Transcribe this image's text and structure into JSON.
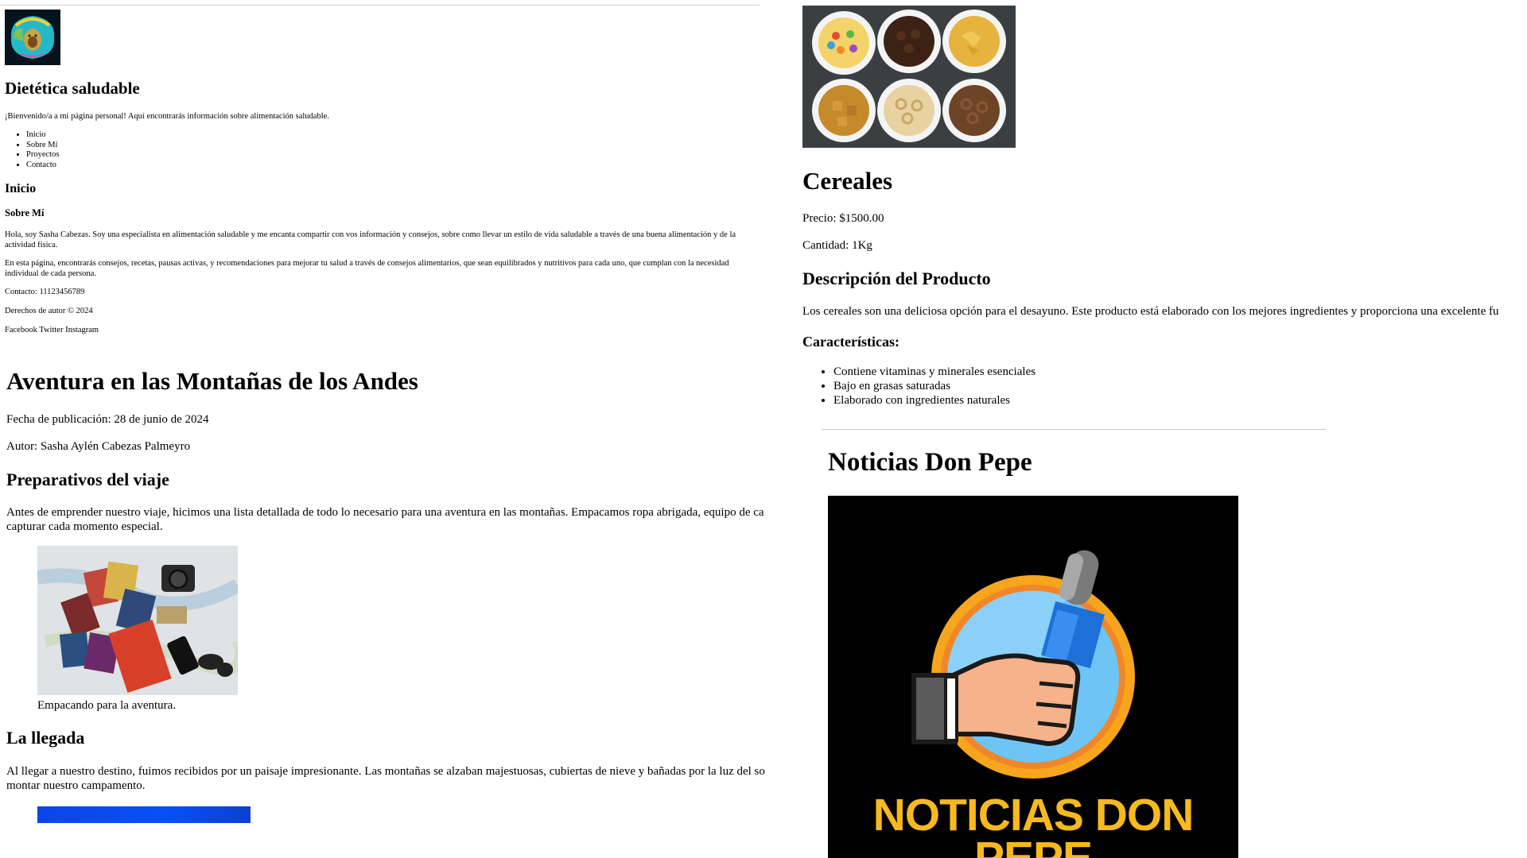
{
  "dietetica": {
    "logo_icon": "avocado-logo",
    "title": "Dietética saludable",
    "welcome": "¡Bienvenido/a a mi página personal! Aquí encontrarás información sobre alimentación saludable.",
    "nav": [
      "Inicio",
      "Sobre Mí",
      "Proyectos",
      "Contacto"
    ],
    "section_inicio": "Inicio",
    "section_sobre_mi": "Sobre Mí",
    "about_p1": "Hola, soy Sasha Cabezas. Soy una especialista en alimentación saludable y me encanta compartir con vos información y consejos, sobre como llevar un estilo de vida saludable a través de una buena alimentación y de la actividad física.",
    "about_p2": "En esta página, encontrarás consejos, recetas, pausas activas, y recomendaciones para mejorar tu salud a través de consejos alimentarios, que sean equilibrados y nutritivos para cada uno, que cumplan con la necesidad individual de cada persona.",
    "contact": "Contacto: 11123456789",
    "copyright": "Derechos de autor © 2024",
    "social": [
      "Facebook",
      "Twitter",
      "Instagram"
    ]
  },
  "aventura": {
    "title": "Aventura en las Montañas de los Andes",
    "date": "Fecha de publicación: 28 de junio de 2024",
    "author": "Autor: Sasha Aylén Cabezas Palmeyro",
    "section1_title": "Preparativos del viaje",
    "section1_text": "Antes de emprender nuestro viaje, hicimos una lista detallada de todo lo necesario para una aventura en las montañas. Empacamos ropa abrigada, equipo de ca",
    "section1_text_line2": "capturar cada momento especial.",
    "figure_caption": "Empacando para la aventura.",
    "section2_title": "La llegada",
    "section2_text": "Al llegar a nuestro destino, fuimos recibidos por un paisaje impresionante. Las montañas se alzaban majestuosas, cubiertas de nieve y bañadas por la luz del so",
    "section2_text_line2": "montar nuestro campamento."
  },
  "cereales": {
    "title": "Cereales",
    "price": "Precio: $1500.00",
    "quantity": "Cantidad: 1Kg",
    "desc_title": "Descripción del Producto",
    "description": "Los cereales son una deliciosa opción para el desayuno. Este producto está elaborado con los mejores ingredientes y proporciona una excelente fu",
    "features_title": "Características:",
    "features": [
      "Contiene vitaminas y minerales esenciales",
      "Bajo en grasas saturadas",
      "Elaborado con ingredientes naturales"
    ]
  },
  "noticias": {
    "title": "Noticias Don Pepe",
    "logo_line1": "NOTICIAS DON",
    "logo_line2": "PEPE",
    "logo_icon": "microphone-hand-icon"
  }
}
